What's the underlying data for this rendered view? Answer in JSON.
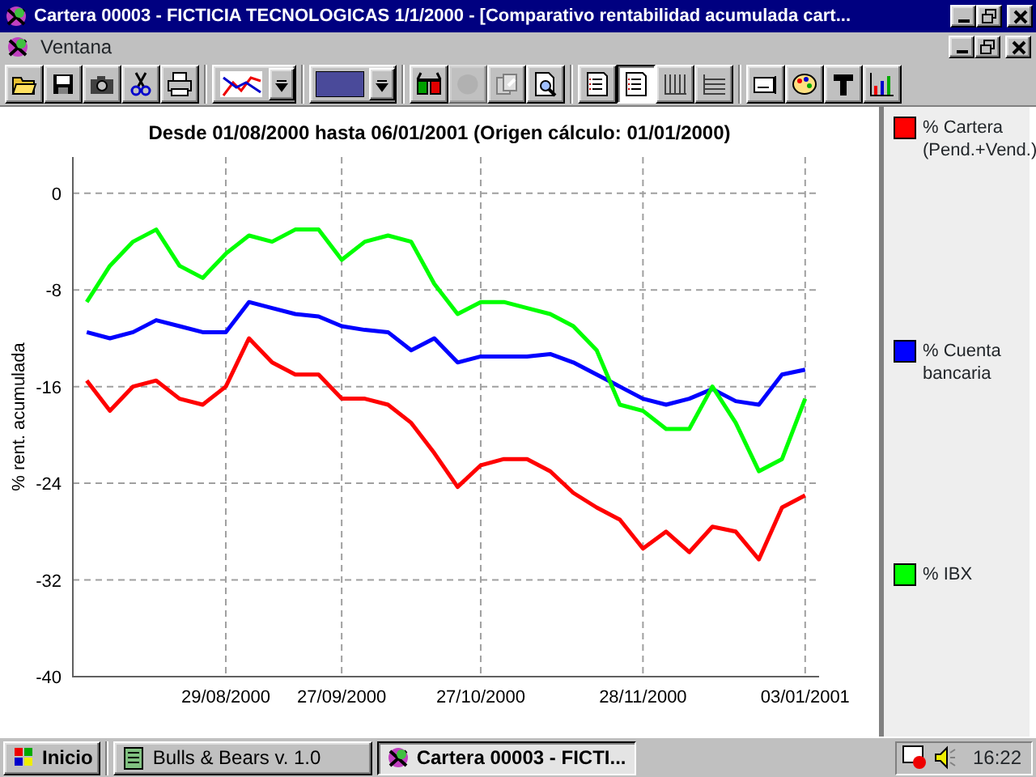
{
  "window": {
    "title": "Cartera 00003 - FICTICIA TECNOLOGICAS 1/1/2000 - [Comparativo rentabilidad acumulada cart..."
  },
  "menu": [
    "Ventana"
  ],
  "toolbar": [
    {
      "kind": "open",
      "pressed": false,
      "disabled": false
    },
    {
      "kind": "save",
      "pressed": false,
      "disabled": false
    },
    {
      "kind": "camera",
      "pressed": false,
      "disabled": false
    },
    {
      "kind": "cut",
      "pressed": false,
      "disabled": false
    },
    {
      "kind": "print",
      "pressed": false,
      "disabled": false
    },
    {
      "kind": "chart-type",
      "pressed": false,
      "disabled": false
    },
    {
      "kind": "color",
      "pressed": false,
      "disabled": false
    },
    {
      "kind": "glasses",
      "pressed": false,
      "disabled": false
    },
    {
      "kind": "blob",
      "pressed": false,
      "disabled": true
    },
    {
      "kind": "copy",
      "pressed": false,
      "disabled": false
    },
    {
      "kind": "preview",
      "pressed": false,
      "disabled": false
    },
    {
      "kind": "list",
      "pressed": false,
      "disabled": false
    },
    {
      "kind": "list",
      "pressed": true,
      "disabled": false
    },
    {
      "kind": "vgrid",
      "pressed": false,
      "disabled": false
    },
    {
      "kind": "hgrid",
      "pressed": false,
      "disabled": false
    },
    {
      "kind": "text",
      "pressed": false,
      "disabled": false
    },
    {
      "kind": "palette",
      "pressed": false,
      "disabled": false
    },
    {
      "kind": "font",
      "pressed": false,
      "disabled": false
    },
    {
      "kind": "bars",
      "pressed": false,
      "disabled": false
    }
  ],
  "graph": {
    "chart_data": {
      "type": "line",
      "title": "Desde 01/08/2000 hasta 06/01/2001 (Origen cálculo: 01/01/2000)",
      "ylabel": "% rent. acumulada",
      "categories": [
        null,
        null,
        null,
        null,
        null,
        null,
        "29/08/2000",
        null,
        null,
        null,
        null,
        "27/09/2000",
        null,
        null,
        null,
        null,
        null,
        "27/10/2000",
        null,
        null,
        null,
        null,
        null,
        null,
        "28/11/2000",
        null,
        null,
        null,
        null,
        null,
        null,
        "03/01/2001"
      ],
      "ylim": [
        -40,
        3
      ],
      "grid": true,
      "yticks": [
        0,
        -8,
        -16,
        -24,
        -32,
        -40
      ],
      "series": [
        {
          "name": "% Cartera (Pend.+Vend.)",
          "color": "#ff0000",
          "values": [
            -15.5,
            -18,
            -16,
            -15.5,
            -17,
            -17.5,
            -16,
            -12,
            -14,
            -15,
            -15,
            -17,
            -17,
            -17.5,
            -19,
            -21.5,
            -24.3,
            -22.5,
            -22,
            -22,
            -23,
            -24.8,
            -26,
            -27,
            -29.4,
            -28,
            -29.7,
            -27.6,
            -28,
            -30.3,
            -26,
            -25
          ]
        },
        {
          "name": "% Cuenta bancaria",
          "color": "#0000ff",
          "values": [
            -11.5,
            -12,
            -11.5,
            -10.5,
            -11,
            -11.5,
            -11.5,
            -9,
            -9.5,
            -10,
            -10.2,
            -11,
            -11.3,
            -11.5,
            -13,
            -12,
            -14,
            -13.5,
            -13.5,
            -13.5,
            -13.3,
            -14,
            -15,
            -16,
            -17,
            -17.5,
            -17,
            -16.2,
            -17.2,
            -17.5,
            -15,
            -14.6
          ]
        },
        {
          "name": "% IBX",
          "color": "#00ff00",
          "values": [
            -9,
            -6,
            -4,
            -3,
            -6,
            -7,
            -5,
            -3.5,
            -4,
            -3,
            -3,
            -5.5,
            -4,
            -3.5,
            -4,
            -7.5,
            -10,
            -9,
            -9,
            -9.5,
            -10,
            -11,
            -13,
            -17.5,
            -18,
            -19.5,
            -19.5,
            -16,
            -19,
            -23,
            -22,
            -17
          ]
        }
      ]
    }
  },
  "taskbar": {
    "start": "Inicio",
    "tasks": [
      {
        "label": "Bulls & Bears v. 1.0",
        "active": false
      },
      {
        "label": "Cartera 00003 - FICTI...",
        "active": true
      }
    ],
    "clock": "16:22"
  }
}
